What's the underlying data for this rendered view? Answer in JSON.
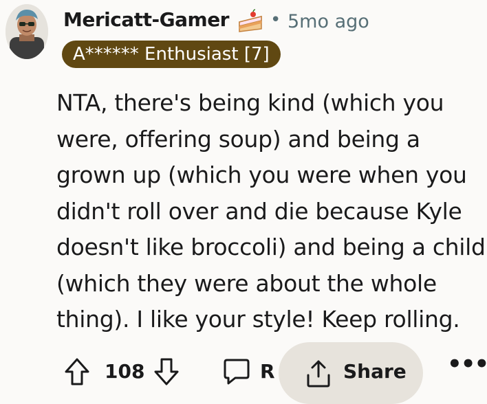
{
  "comment": {
    "username": "Mericatt-Gamer",
    "separator": "•",
    "timestamp": "5mo ago",
    "flair": "A****** Enthusiast [7]",
    "body": "NTA, there's being kind (which you\nwere, offering soup) and being a\ngrown up (which you were when you\ndidn't roll over and die because Kyle\ndoesn't like broccoli) and being a child\n(which they were about the whole\nthing). I like your style! Keep rolling."
  },
  "actions": {
    "score": "108",
    "reply_label": "R",
    "share_label": "Share",
    "more_label": "•••"
  },
  "icons": {
    "avatar": "avatar-icon",
    "cake": "cake-day-icon",
    "upvote": "upvote-icon",
    "downvote": "downvote-icon",
    "comment": "comment-icon",
    "share": "share-icon"
  },
  "colors": {
    "flair_bg": "#604812",
    "meta_text": "#576f76",
    "share_bg": "#e7e3dc"
  }
}
